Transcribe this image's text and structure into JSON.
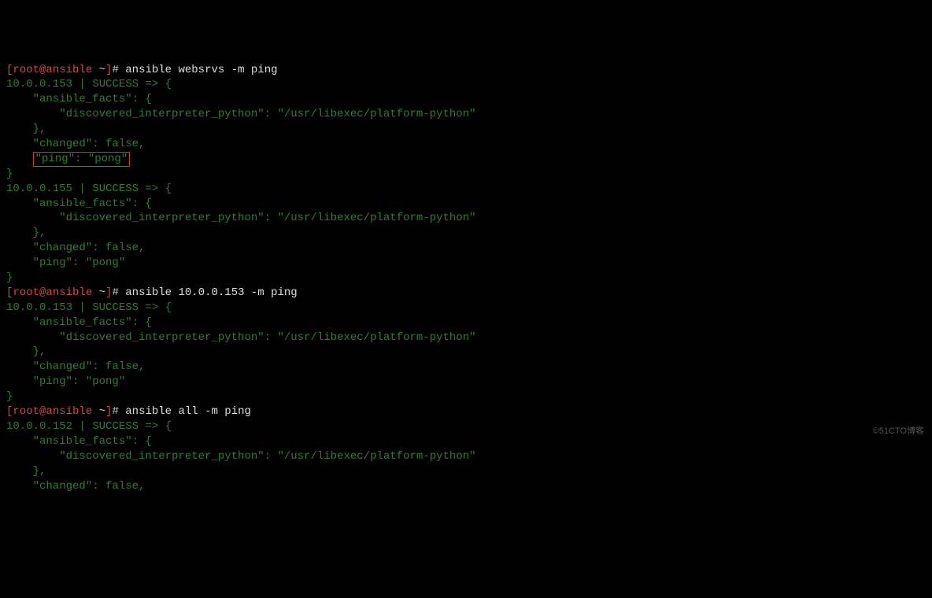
{
  "prompt": {
    "open_bracket": "[",
    "user": "root",
    "at": "@",
    "host": "ansible",
    "tilde": " ~",
    "close_bracket": "]",
    "hash": "# "
  },
  "commands": {
    "cmd1": "ansible websrvs -m ping",
    "cmd2": "ansible 10.0.0.153 -m ping",
    "cmd3": "ansible all -m ping"
  },
  "output1": {
    "l1": "10.0.0.153 | SUCCESS => {",
    "l2": "    \"ansible_facts\": {",
    "l3": "        \"discovered_interpreter_python\": \"/usr/libexec/platform-python\"",
    "l4": "    },",
    "l5": "    \"changed\": false,",
    "l6_pre": "    ",
    "l6_box": "\"ping\": \"pong\"",
    "l7": "}",
    "l8": "10.0.0.155 | SUCCESS => {",
    "l9": "    \"ansible_facts\": {",
    "l10": "        \"discovered_interpreter_python\": \"/usr/libexec/platform-python\"",
    "l11": "    },",
    "l12": "    \"changed\": false,",
    "l13": "    \"ping\": \"pong\"",
    "l14": "}"
  },
  "output2": {
    "l1": "10.0.0.153 | SUCCESS => {",
    "l2": "    \"ansible_facts\": {",
    "l3": "        \"discovered_interpreter_python\": \"/usr/libexec/platform-python\"",
    "l4": "    },",
    "l5": "    \"changed\": false,",
    "l6": "    \"ping\": \"pong\"",
    "l7": "}"
  },
  "output3": {
    "l1": "10.0.0.152 | SUCCESS => {",
    "l2": "    \"ansible_facts\": {",
    "l3": "        \"discovered_interpreter_python\": \"/usr/libexec/platform-python\"",
    "l4": "    },",
    "l5": "    \"changed\": false,"
  },
  "watermark": "©51CTO博客"
}
